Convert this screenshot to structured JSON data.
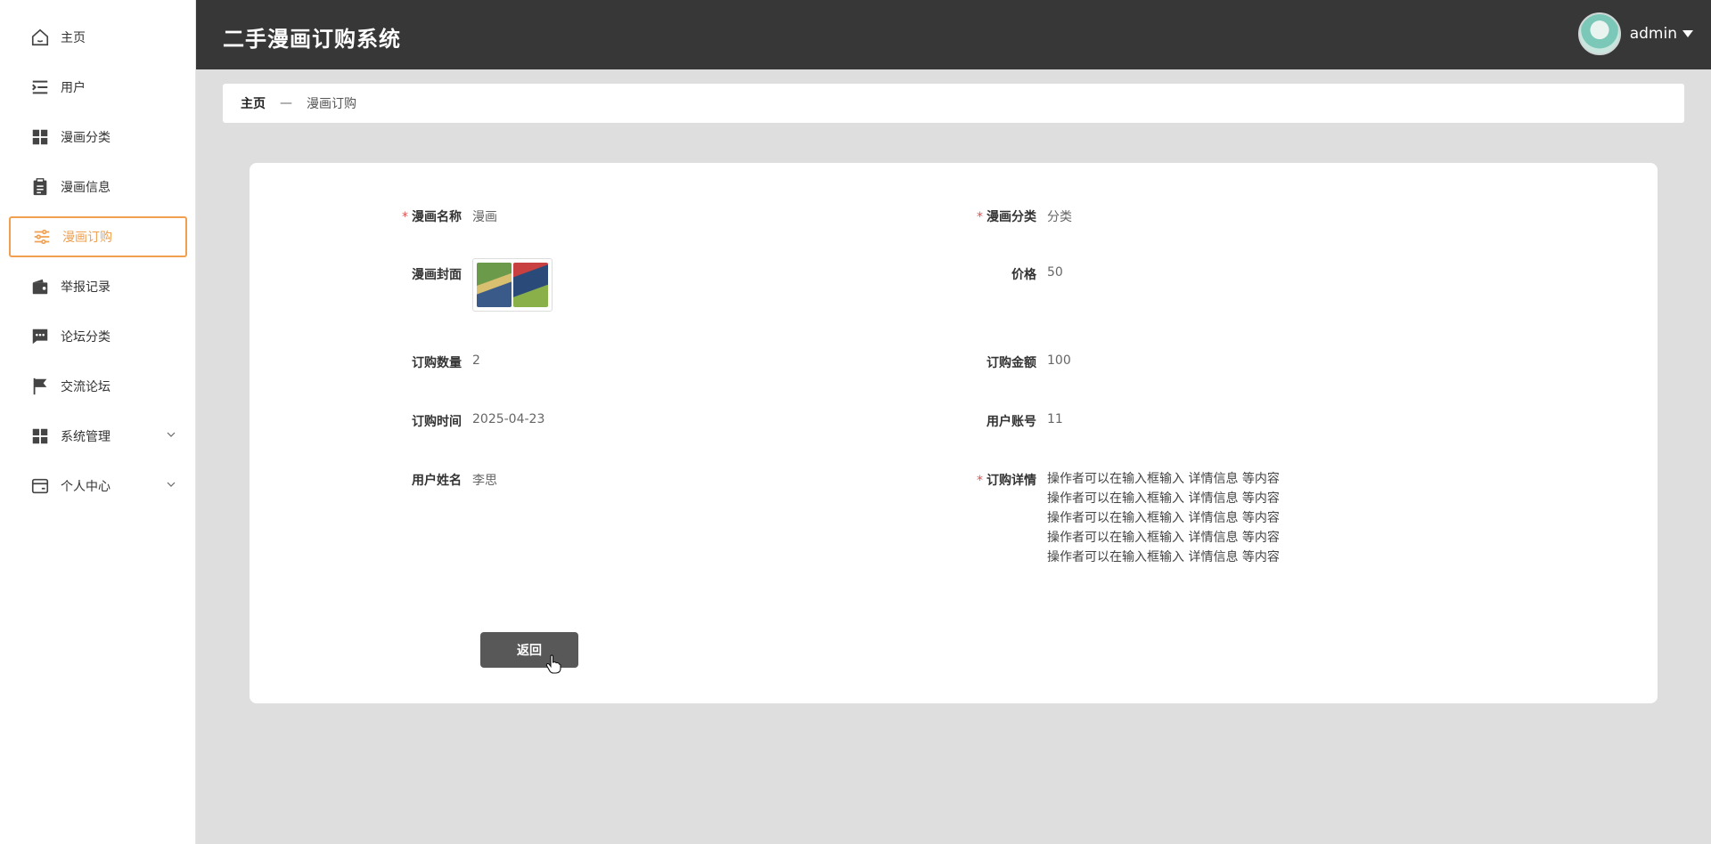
{
  "header": {
    "title": "二手漫画订购系统",
    "username": "admin"
  },
  "sidebar": {
    "items": [
      {
        "label": "主页"
      },
      {
        "label": "用户"
      },
      {
        "label": "漫画分类"
      },
      {
        "label": "漫画信息"
      },
      {
        "label": "漫画订购"
      },
      {
        "label": "举报记录"
      },
      {
        "label": "论坛分类"
      },
      {
        "label": "交流论坛"
      },
      {
        "label": "系统管理"
      },
      {
        "label": "个人中心"
      }
    ]
  },
  "breadcrumb": {
    "home": "主页",
    "separator": "—",
    "current": "漫画订购"
  },
  "form": {
    "name_label": "漫画名称",
    "name_value": "漫画",
    "category_label": "漫画分类",
    "category_value": "分类",
    "cover_label": "漫画封面",
    "price_label": "价格",
    "price_value": "50",
    "qty_label": "订购数量",
    "qty_value": "2",
    "amount_label": "订购金额",
    "amount_value": "100",
    "time_label": "订购时间",
    "time_value": "2025-04-23",
    "account_label": "用户账号",
    "account_value": "11",
    "username_label": "用户姓名",
    "username_value": "李思",
    "details_label": "订购详情",
    "details_lines": [
      "操作者可以在输入框输入 详情信息 等内容",
      "操作者可以在输入框输入 详情信息 等内容",
      "操作者可以在输入框输入 详情信息 等内容",
      "操作者可以在输入框输入 详情信息 等内容",
      "操作者可以在输入框输入 详情信息 等内容"
    ],
    "back_button": "返回"
  },
  "required_mark": "*",
  "colors": {
    "accent": "#f0a050",
    "header_bg": "#373737",
    "required": "#e05050",
    "button_bg": "#585858"
  }
}
